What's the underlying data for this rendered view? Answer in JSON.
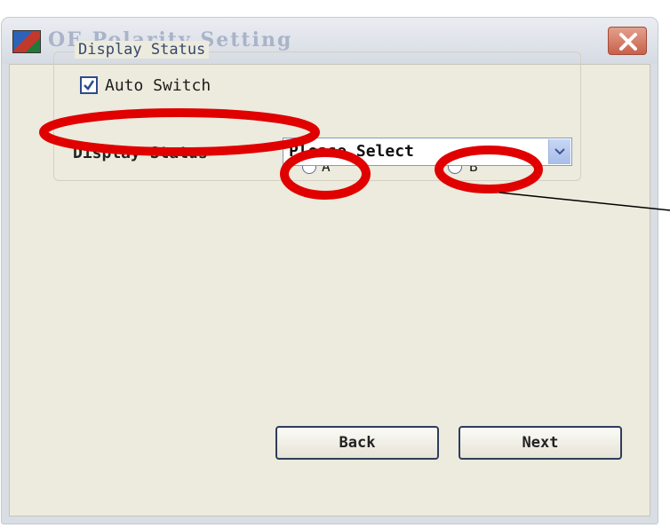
{
  "window": {
    "title": "OE Polarity Setting",
    "icons": {
      "app": "app-icon",
      "close": "close-icon"
    }
  },
  "group": {
    "legend": "Display Status",
    "auto_switch": {
      "label": "Auto Switch",
      "checked": true
    },
    "radio_a": {
      "label": "A",
      "selected": false
    },
    "radio_b": {
      "label": "B",
      "selected": false
    },
    "status_label": "Display Status",
    "status_select": {
      "value": "Please Select"
    }
  },
  "footer": {
    "back_label": "Back",
    "next_label": "Next"
  },
  "annotations": {
    "highlight_color": "#e00000"
  }
}
